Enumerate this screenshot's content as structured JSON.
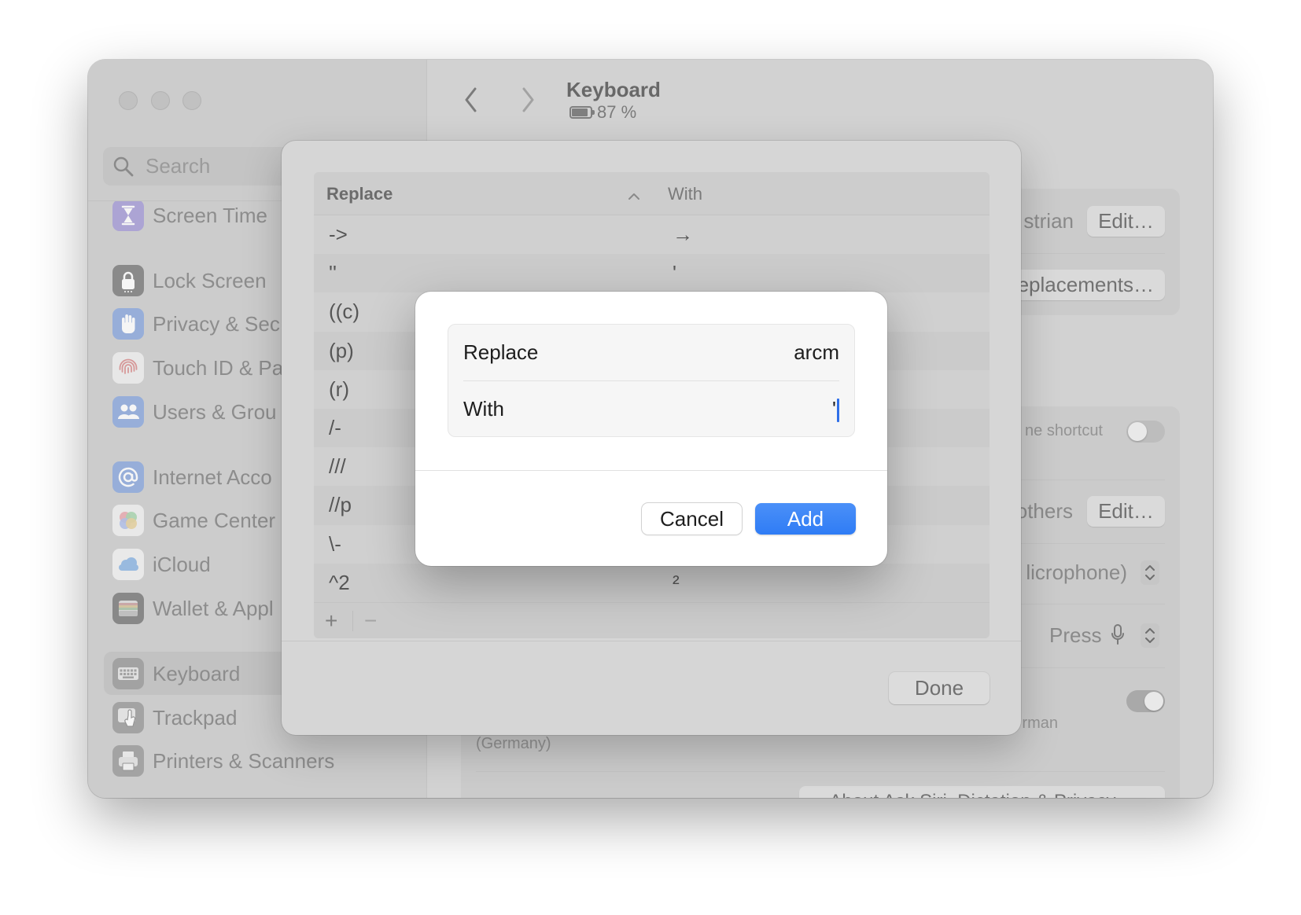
{
  "window": {
    "title": "Keyboard",
    "battery_text": "87 %",
    "battery_level": 0.87
  },
  "sidebar": {
    "search_placeholder": "Search",
    "selected": "Keyboard",
    "items": [
      {
        "label": "Screen Time",
        "icon": "hourglass-icon"
      },
      {
        "label": "Lock Screen",
        "icon": "lock-icon"
      },
      {
        "label": "Privacy & Sec",
        "icon": "hand-icon"
      },
      {
        "label": "Touch ID & Pa",
        "icon": "fingerprint-icon"
      },
      {
        "label": "Users & Grou",
        "icon": "users-icon"
      },
      {
        "label": "Internet Acco",
        "icon": "at-icon"
      },
      {
        "label": "Game Center",
        "icon": "game-center-icon"
      },
      {
        "label": "iCloud",
        "icon": "cloud-icon"
      },
      {
        "label": "Wallet & Appl",
        "icon": "wallet-icon"
      },
      {
        "label": "Keyboard",
        "icon": "keyboard-icon"
      },
      {
        "label": "Trackpad",
        "icon": "trackpad-icon"
      },
      {
        "label": "Printers & Scanners",
        "icon": "printer-icon"
      }
    ]
  },
  "settings": {
    "input_source_text": "strian",
    "edit_label": "Edit…",
    "text_replacements_label": "eplacements…",
    "shortcut_text": "ne shortcut",
    "shortcut_toggle_on": false,
    "others_text": "others",
    "edit2_label": "Edit…",
    "microphone_text": "licrophone)",
    "press_text": "Press",
    "dictation_toggle_on": true,
    "language_text": "rman",
    "region_text": "(Germany)",
    "about_label": "About Ask Siri, Dictation & Privacy…"
  },
  "sheet": {
    "column_replace": "Replace",
    "column_with": "With",
    "rows": [
      {
        "replace": "->",
        "with": "→"
      },
      {
        "replace": "''",
        "with": "'"
      },
      {
        "replace": "((c)"
      },
      {
        "replace": "(p)"
      },
      {
        "replace": "(r)"
      },
      {
        "replace": "/-"
      },
      {
        "replace": "///"
      },
      {
        "replace": "//p"
      },
      {
        "replace": "\\-"
      },
      {
        "replace": "^2",
        "with": "²"
      }
    ],
    "add_row_label": "+",
    "remove_row_label": "−",
    "done_label": "Done"
  },
  "dialog": {
    "replace_label": "Replace",
    "replace_value": "arcm",
    "with_label": "With",
    "with_value": "'",
    "cancel_label": "Cancel",
    "add_label": "Add"
  },
  "colors": {
    "accent": "#2f7cf5",
    "caret": "#2f6fe8"
  }
}
